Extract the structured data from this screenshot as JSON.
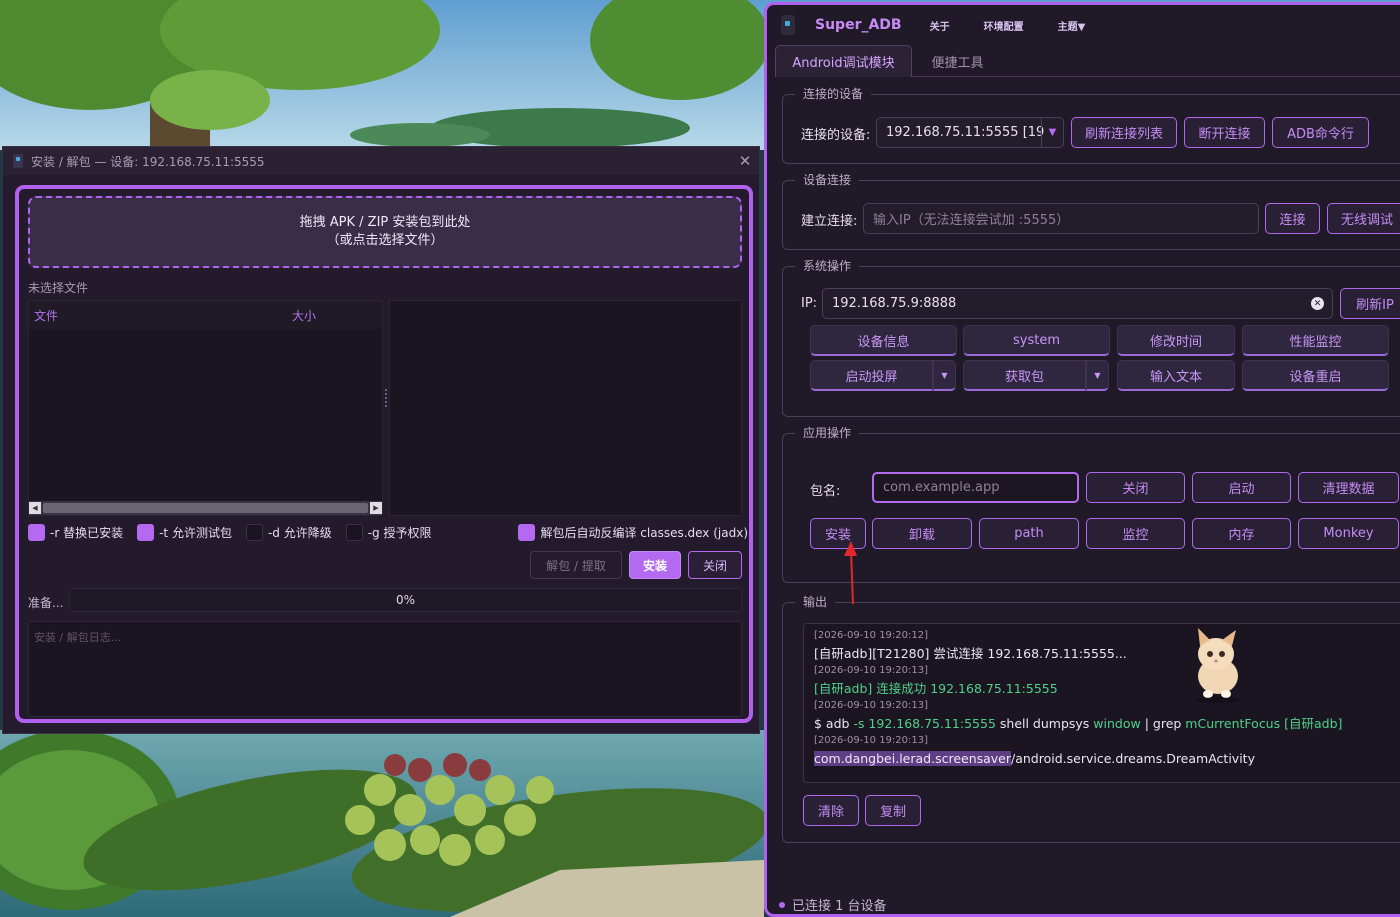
{
  "dialog": {
    "title": "安装 / 解包 — 设备: 192.168.75.11:5555",
    "drop_line1": "拖拽 APK / ZIP 安装包到此处",
    "drop_line2": "（或点击选择文件）",
    "file_status": "未选择文件",
    "col_file": "文件",
    "col_size": "大小",
    "options": {
      "replace": "-r 替换已安装",
      "test": "-t 允许测试包",
      "downgrade": "-d 允许降级",
      "grant": "-g 授予权限",
      "jadx": "解包后自动反编译 classes.dex (jadx)"
    },
    "btn_extract": "解包 / 提取",
    "btn_install": "安装",
    "btn_close": "关闭",
    "progress_label": "准备...",
    "progress_value": "0%",
    "log_placeholder": "安装 / 解包日志..."
  },
  "main": {
    "brand": "Super_ADB",
    "menu": [
      "关于",
      "环境配置",
      "主题▼"
    ],
    "tabs": [
      "Android调试模块",
      "便捷工具"
    ],
    "connected": {
      "title": "连接的设备",
      "label": "连接的设备:",
      "device": "192.168.75.11:5555  [19",
      "refresh": "刷新连接列表",
      "disconnect": "断开连接",
      "adb_cmd": "ADB命令行"
    },
    "connect": {
      "title": "设备连接",
      "label": "建立连接:",
      "placeholder": "输入IP（无法连接尝试加 :5555）",
      "btn_connect": "连接",
      "btn_wireless": "无线调试"
    },
    "system": {
      "title": "系统操作",
      "ip_label": "IP:",
      "ip_value": "192.168.75.9:8888",
      "refresh_ip": "刷新IP",
      "row1": [
        "设备信息",
        "system",
        "修改时间",
        "性能监控"
      ],
      "mirror": "启动投屏",
      "get_pkg": "获取包",
      "input_text": "输入文本",
      "reboot": "设备重启"
    },
    "app": {
      "title": "应用操作",
      "pkg_label": "包名:",
      "pkg_placeholder": "com.example.app",
      "row1": [
        "关闭",
        "启动",
        "清理数据"
      ],
      "row2": [
        "安装",
        "卸载",
        "path",
        "监控",
        "内存",
        "Monkey"
      ]
    },
    "output": {
      "title": "输出",
      "ts1": "[2026-09-10 19:20:12]",
      "line1": "[自研adb][T21280] 尝试连接 192.168.75.11:5555...",
      "ts2": "[2026-09-10 19:20:13]",
      "line2": "[自研adb] 连接成功 192.168.75.11:5555",
      "ts3": "[2026-09-10 19:20:13]",
      "line3_a": "$ adb ",
      "line3_b": "-s 192.168.75.11:5555",
      "line3_c": " shell dumpsys ",
      "line3_d": "window",
      "line3_e": " | grep ",
      "line3_f": "mCurrentFocus [自研adb]",
      "ts4": "[2026-09-10 19:20:13]",
      "line4_hl": "com.dangbei.lerad.screensaver",
      "line4_rest": "/android.service.dreams.DreamActivity",
      "btn_clear": "清除",
      "btn_copy": "复制"
    },
    "status": "已连接 1 台设备"
  },
  "colors": {
    "accent": "#b36af0",
    "success": "#4fd08a",
    "panel": "#201a28"
  }
}
